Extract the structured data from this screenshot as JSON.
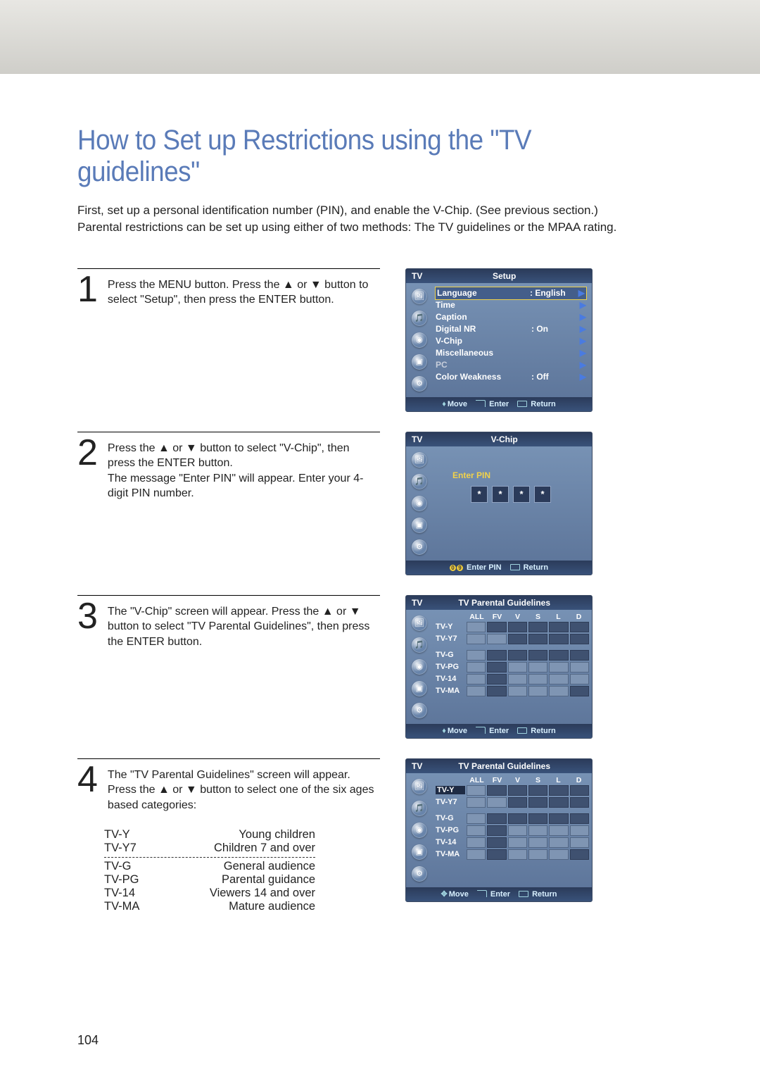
{
  "page_title": "How to Set up Restrictions using the \"TV guidelines\"",
  "intro1": "First, set up a personal identification number (PIN), and enable the V-Chip. (See previous section.)",
  "intro2": "Parental restrictions can be set up using either of two methods: The TV guidelines or the MPAA rating.",
  "page_number": "104",
  "steps": {
    "s1": {
      "num": "1",
      "text": "Press the MENU button. Press the ▲ or ▼ button to select \"Setup\", then press the ENTER button."
    },
    "s2": {
      "num": "2",
      "text": "Press the ▲ or ▼ button to select \"V-Chip\", then press the ENTER button.\nThe message \"Enter PIN\" will appear. Enter your 4-digit PIN number."
    },
    "s3": {
      "num": "3",
      "text": "The \"V-Chip\" screen will appear. Press the ▲ or ▼ button to select \"TV Parental Guidelines\", then press the ENTER button."
    },
    "s4": {
      "num": "4",
      "text": "The \"TV Parental Guidelines\" screen will appear. Press the ▲ or ▼ button to select one of the six ages based categories:"
    }
  },
  "ratings": [
    {
      "code": "TV-Y",
      "desc": "Young children"
    },
    {
      "code": "TV-Y7",
      "desc": "Children 7 and over"
    },
    {
      "code": "TV-G",
      "desc": "General audience"
    },
    {
      "code": "TV-PG",
      "desc": "Parental guidance"
    },
    {
      "code": "TV-14",
      "desc": "Viewers 14 and over"
    },
    {
      "code": "TV-MA",
      "desc": "Mature audience"
    }
  ],
  "osd": {
    "tv_label": "TV",
    "footer": {
      "move": "Move",
      "enter": "Enter",
      "return": "Return",
      "enterpin": "Enter PIN",
      "move4": "Move"
    },
    "setup": {
      "title": "Setup",
      "items": [
        {
          "label": "Language",
          "val": ":  English"
        },
        {
          "label": "Time",
          "val": ""
        },
        {
          "label": "Caption",
          "val": ""
        },
        {
          "label": "Digital NR",
          "val": ":  On"
        },
        {
          "label": "V-Chip",
          "val": ""
        },
        {
          "label": "Miscellaneous",
          "val": ""
        },
        {
          "label": "PC",
          "val": ""
        },
        {
          "label": "Color Weakness",
          "val": ":  Off"
        }
      ]
    },
    "vchip": {
      "title": "V-Chip",
      "prompt": "Enter PIN",
      "mask": "*"
    },
    "guidelines": {
      "title": "TV Parental Guidelines",
      "cols": [
        "ALL",
        "FV",
        "V",
        "S",
        "L",
        "D"
      ],
      "rows": [
        "TV-Y",
        "TV-Y7",
        "TV-G",
        "TV-PG",
        "TV-14",
        "TV-MA"
      ]
    }
  }
}
